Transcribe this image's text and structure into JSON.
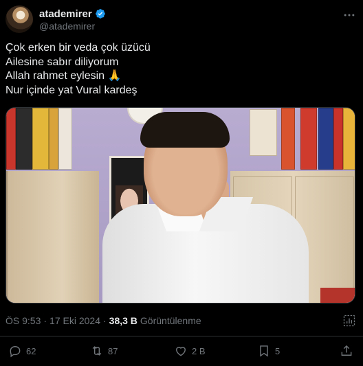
{
  "author": {
    "display_name": "atademirer",
    "handle": "@atademirer",
    "verified": true
  },
  "tweet": {
    "lines": [
      "Çok erken bir veda çok üzücü",
      "Ailesine sabır diliyorum",
      "Allah rahmet eylesin 🙏",
      "Nur içinde yat Vural kardeş"
    ]
  },
  "meta": {
    "time": "ÖS 9:53",
    "separator": "·",
    "date": "17 Eki 2024",
    "separator2": "·",
    "views_count": "38,3 B",
    "views_label": "Görüntülenme"
  },
  "actions": {
    "reply_count": "62",
    "retweet_count": "87",
    "like_count": "2 B",
    "bookmark_count": "5"
  },
  "colors": {
    "background": "#000000",
    "text": "#e7e9ea",
    "muted": "#71767b",
    "verified": "#1d9bf0",
    "divider": "#2f3336"
  },
  "icons": [
    "verified-badge-icon",
    "more-icon",
    "analytics-icon",
    "reply-icon",
    "retweet-icon",
    "like-icon",
    "bookmark-icon",
    "share-icon"
  ]
}
